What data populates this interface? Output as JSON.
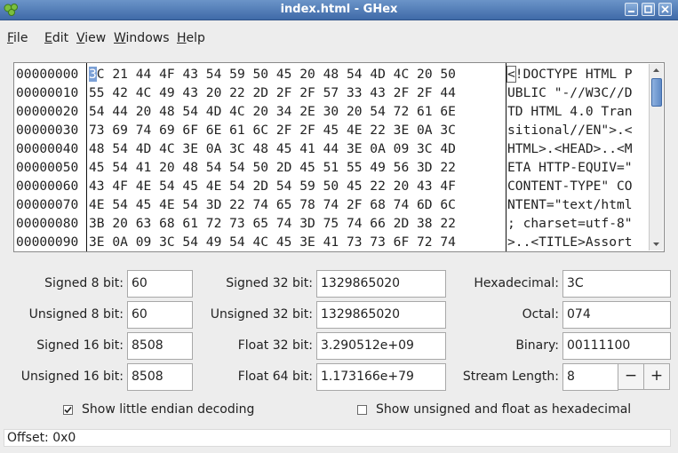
{
  "window": {
    "title": "index.html - GHex"
  },
  "menu": {
    "items": [
      "File",
      "Edit",
      "View",
      "Windows",
      "Help"
    ]
  },
  "hex": {
    "offsets": [
      "00000000",
      "00000010",
      "00000020",
      "00000030",
      "00000040",
      "00000050",
      "00000060",
      "00000070",
      "00000080",
      "00000090"
    ],
    "hex_first_rest": "C 21 44 4F 43 54 59 50 45 20 48 54 4D 4C 20 50",
    "hex_first_cursor": "3",
    "hex_rows_rest": [
      "55 42 4C 49 43 20 22 2D 2F 2F 57 33 43 2F 2F 44",
      "54 44 20 48 54 4D 4C 20 34 2E 30 20 54 72 61 6E",
      "73 69 74 69 6F 6E 61 6C 2F 2F 45 4E 22 3E 0A 3C",
      "48 54 4D 4C 3E 0A 3C 48 45 41 44 3E 0A 09 3C 4D",
      "45 54 41 20 48 54 54 50 2D 45 51 55 49 56 3D 22",
      "43 4F 4E 54 45 4E 54 2D 54 59 50 45 22 20 43 4F",
      "4E 54 45 4E 54 3D 22 74 65 78 74 2F 68 74 6D 6C",
      "3B 20 63 68 61 72 73 65 74 3D 75 74 66 2D 38 22",
      "3E 0A 09 3C 54 49 54 4C 45 3E 41 73 73 6F 72 74"
    ],
    "ascii_first_cursor": "<",
    "ascii_first_rest": "!DOCTYPE HTML P",
    "ascii_rows_rest": [
      "UBLIC \"-//W3C//D",
      "TD HTML 4.0 Tran",
      "sitional//EN\">.<",
      "HTML>.<HEAD>..<M",
      "ETA HTTP-EQUIV=\"",
      "CONTENT-TYPE\" CO",
      "NTENT=\"text/html",
      "; charset=utf-8\"",
      ">..<TITLE>Assort"
    ]
  },
  "conversions": {
    "signed8_label": "Signed 8 bit:",
    "signed8": "60",
    "unsigned8_label": "Unsigned 8 bit:",
    "unsigned8": "60",
    "signed16_label": "Signed 16 bit:",
    "signed16": "8508",
    "unsigned16_label": "Unsigned 16 bit:",
    "unsigned16": "8508",
    "signed32_label": "Signed 32 bit:",
    "signed32": "1329865020",
    "unsigned32_label": "Unsigned 32 bit:",
    "unsigned32": "1329865020",
    "float32_label": "Float 32 bit:",
    "float32": "3.290512e+09",
    "float64_label": "Float 64 bit:",
    "float64": "1.173166e+79",
    "hex_label": "Hexadecimal:",
    "hexadecimal": "3C",
    "octal_label": "Octal:",
    "octal": "074",
    "binary_label": "Binary:",
    "binary": "00111100",
    "stream_label": "Stream Length:",
    "stream_length": "8",
    "minus": "−",
    "plus": "+"
  },
  "options": {
    "little_endian_label": "Show little endian decoding",
    "little_endian_checked": true,
    "unsigned_hex_label": "Show unsigned and float as hexadecimal",
    "unsigned_hex_checked": false
  },
  "status": {
    "offset": "Offset: 0x0"
  },
  "colors": {
    "titlebar": "#4f7bb9",
    "cursor": "#7ba0d6"
  }
}
